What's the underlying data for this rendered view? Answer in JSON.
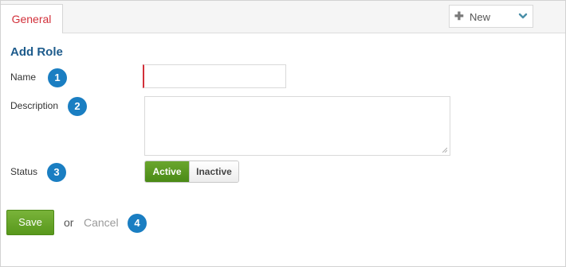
{
  "tabs": [
    {
      "label": "General"
    }
  ],
  "new_dropdown": {
    "label": "New",
    "icon_left": "plus-icon",
    "icon_right": "chevron-down-icon"
  },
  "form": {
    "title": "Add Role",
    "fields": {
      "name": {
        "label": "Name",
        "value": ""
      },
      "description": {
        "label": "Description",
        "value": ""
      },
      "status": {
        "label": "Status",
        "options": [
          "Active",
          "Inactive"
        ],
        "selected": "Active"
      }
    },
    "actions": {
      "save_label": "Save",
      "or_text": "or",
      "cancel_label": "Cancel"
    }
  },
  "badges": [
    "1",
    "2",
    "3",
    "4"
  ],
  "colors": {
    "tab_active_text": "#d2303a",
    "title": "#1d5b8c",
    "badge": "#1a7ec2",
    "active_green": "#58981c",
    "required_marker": "#d2303a"
  }
}
